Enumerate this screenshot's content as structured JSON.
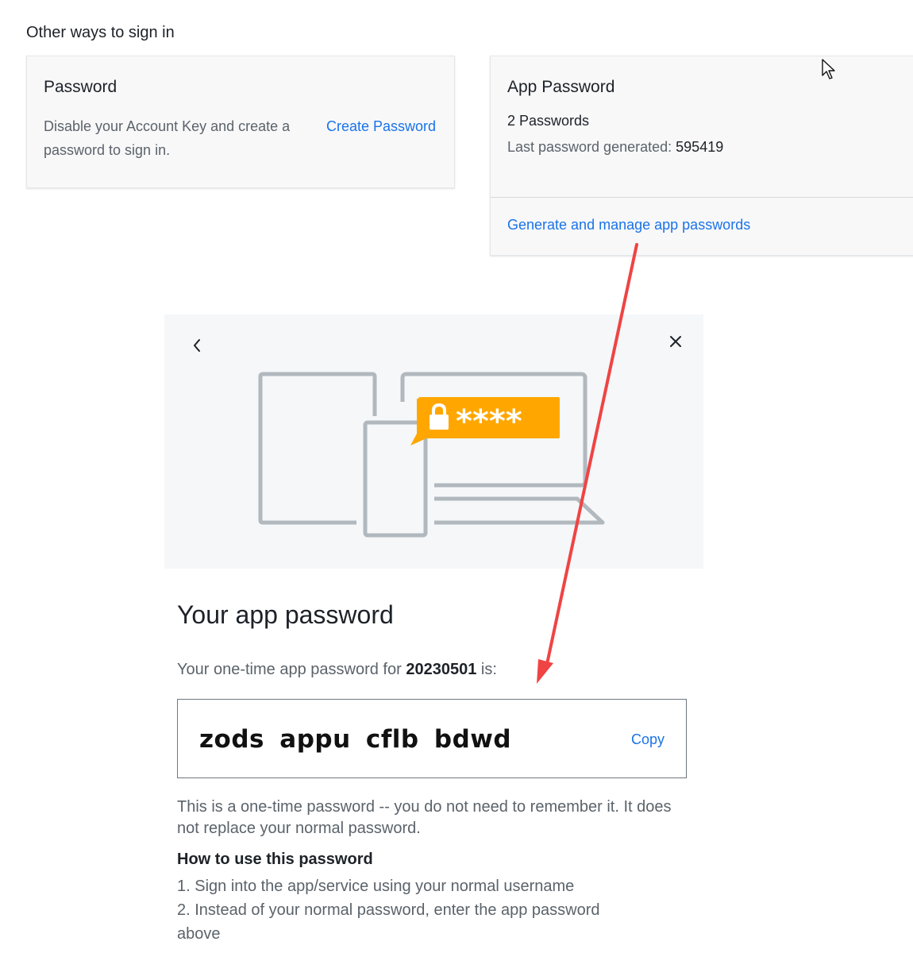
{
  "section": {
    "title": "Other ways to sign in"
  },
  "password_card": {
    "title": "Password",
    "description": "Disable your Account Key and create a password to sign in.",
    "link": "Create Password"
  },
  "app_password_card": {
    "title": "App Password",
    "count": "2 Passwords",
    "last_generated_label": "Last password generated:",
    "last_generated_value": "595419",
    "link": "Generate and manage app passwords"
  },
  "modal": {
    "illustration_text": "****",
    "title": "Your app password",
    "intro_prefix": "Your one-time app password for",
    "intro_app": "20230501",
    "intro_suffix": "is:",
    "password": "zods appu cflb bdwd",
    "copy": "Copy",
    "note": "This is a one-time password -- you do not need to remember it. It does not replace your normal password.",
    "howto_title": "How to use this password",
    "steps": [
      "1. Sign into the app/service using your normal username",
      "2. Instead of your normal password, enter the app password above"
    ]
  },
  "colors": {
    "link": "#1a73e8",
    "accent": "#ffa700",
    "annotation": "#ef4444"
  },
  "icons": [
    "back-chevron-icon",
    "close-icon",
    "lock-icon",
    "mouse-cursor-icon"
  ]
}
